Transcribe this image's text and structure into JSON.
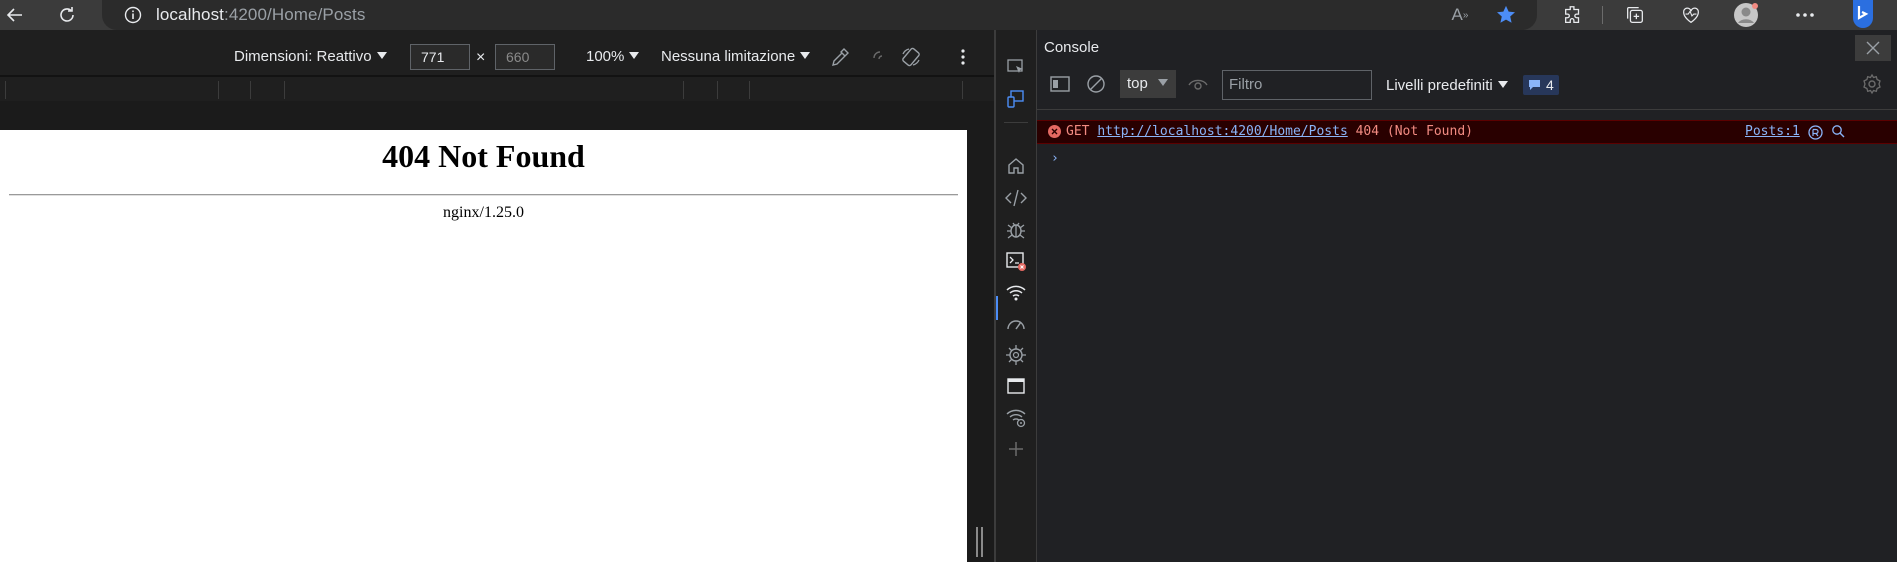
{
  "browser": {
    "url_host": "localhost",
    "url_path": ":4200/Home/Posts",
    "icons": [
      "back-icon",
      "reload-icon",
      "info-icon",
      "read-aloud-icon",
      "favorite-star-icon",
      "extensions-icon",
      "collections-icon",
      "browser-essentials-icon",
      "profile-icon",
      "more-icon",
      "copilot-icon"
    ],
    "read_aloud_label": "A",
    "accent_color": "#4c8df6"
  },
  "device_toolbar": {
    "dimensions_label": "Dimensioni: Reattivo",
    "width": "771",
    "times": "×",
    "height": "660",
    "zoom": "100%",
    "throttling": "Nessuna limitazione"
  },
  "page": {
    "heading": "404 Not Found",
    "server": "nginx/1.25.0"
  },
  "console": {
    "title": "Console",
    "context": "top",
    "filter_placeholder": "Filtro",
    "levels": "Livelli predefiniti",
    "issues_count": "4",
    "error": {
      "method": "GET",
      "url": "http://localhost:4200/Home/Posts",
      "status": "404 (Not Found)",
      "source": "Posts:1"
    },
    "prompt": "›"
  }
}
